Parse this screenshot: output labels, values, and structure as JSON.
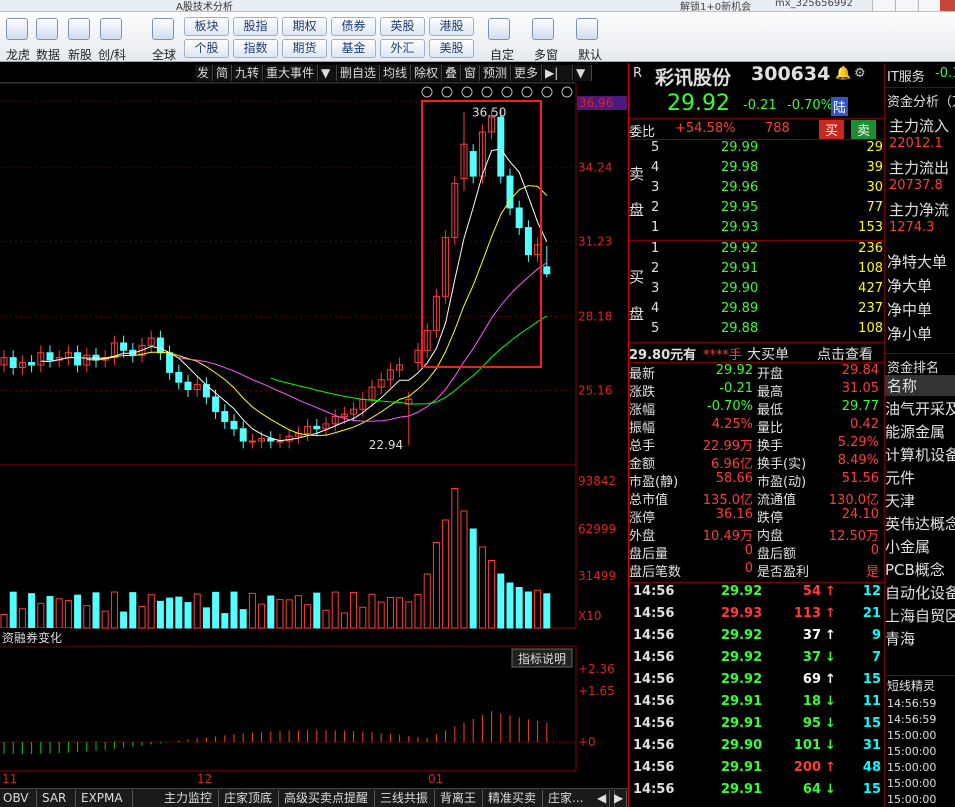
{
  "window": {
    "title": "A股技术分析",
    "notice1": "解锁1+0新机会",
    "notice2": "mx_325656992"
  },
  "toolbar": {
    "labels": [
      "龙虎",
      "数据",
      "新股",
      "创/科",
      "全球"
    ],
    "markets_row1": [
      "板块",
      "股指",
      "期权",
      "债券",
      "英股",
      "港股"
    ],
    "markets_row2": [
      "个股",
      "指数",
      "期货",
      "基金",
      "外汇",
      "美股"
    ],
    "right_labels": [
      "自定",
      "多窗",
      "默认"
    ]
  },
  "chart_toolbar": [
    "发",
    "简",
    "九转",
    "重大事件",
    "▼",
    "删自选",
    "均线",
    "除权",
    "叠",
    "窗",
    "预测",
    "更多",
    "▶|",
    "▼"
  ],
  "chart": {
    "price_axis": [
      "36.96",
      "34.24",
      "31.23",
      "28.18",
      "25.16"
    ],
    "high_label": "36.50",
    "low_label": "22.94",
    "vol_axis": [
      "93842",
      "62999",
      "31499",
      "X10"
    ],
    "macd_axis": [
      "+2.36",
      "+1.65",
      "+0"
    ],
    "x_labels": [
      "11",
      "12",
      "01"
    ],
    "margin_label": "资融券变化",
    "indicator_note": "指标说明"
  },
  "chart_data": {
    "type": "candlestick",
    "title": "",
    "ylim": [
      22.94,
      36.96
    ],
    "high": 36.5,
    "low": 22.94,
    "last": 29.92
  },
  "stock": {
    "flag": "R",
    "name": "彩讯股份",
    "code": "300634",
    "price": "29.92",
    "change": "-0.21",
    "pct": "-0.70%",
    "tag": "陆"
  },
  "weibi": {
    "label": "委比",
    "value": "+54.58%",
    "diff": "788",
    "sell_btn": "买",
    "buy_btn": "卖"
  },
  "sell_label": [
    "卖",
    "盘"
  ],
  "buy_label": [
    "买",
    "盘"
  ],
  "sell": [
    [
      "5",
      "29.99",
      "29"
    ],
    [
      "4",
      "29.98",
      "39"
    ],
    [
      "3",
      "29.96",
      "30"
    ],
    [
      "2",
      "29.95",
      "77"
    ],
    [
      "1",
      "29.93",
      "153"
    ]
  ],
  "buy": [
    [
      "1",
      "29.92",
      "236"
    ],
    [
      "2",
      "29.91",
      "108"
    ],
    [
      "3",
      "29.90",
      "427"
    ],
    [
      "4",
      "29.89",
      "237"
    ],
    [
      "5",
      "29.88",
      "108"
    ]
  ],
  "big_order": {
    "price": "29.80元有",
    "stars": "****手",
    "label": "大买单",
    "link": "点击查看"
  },
  "quote": [
    [
      "最新",
      "29.92",
      "开盘",
      "29.84"
    ],
    [
      "涨跌",
      "-0.21",
      "最高",
      "31.05"
    ],
    [
      "涨幅",
      "-0.70%",
      "最低",
      "29.77"
    ],
    [
      "振幅",
      "4.25%",
      "量比",
      "0.42"
    ],
    [
      "总手",
      "22.99万",
      "换手",
      "5.29%"
    ],
    [
      "金额",
      "6.96亿",
      "换手(实)",
      "8.49%"
    ],
    [
      "市盈(静)",
      "58.66",
      "市盈(动)",
      "51.56"
    ],
    [
      "总市值",
      "135.0亿",
      "流通值",
      "130.0亿"
    ],
    [
      "涨停",
      "36.16",
      "跌停",
      "24.10"
    ],
    [
      "外盘",
      "10.49万",
      "内盘",
      "12.50万"
    ],
    [
      "盘后量",
      "0",
      "盘后额",
      "0"
    ],
    [
      "盘后笔数",
      "0",
      "是否盈利",
      "是"
    ]
  ],
  "ticks": [
    [
      "14:56",
      "29.92",
      "54",
      "12"
    ],
    [
      "14:56",
      "29.93",
      "113",
      "21"
    ],
    [
      "14:56",
      "29.92",
      "37",
      "9"
    ],
    [
      "14:56",
      "29.92",
      "37",
      "7"
    ],
    [
      "14:56",
      "29.92",
      "69",
      "15"
    ],
    [
      "14:56",
      "29.91",
      "18",
      "11"
    ],
    [
      "14:56",
      "29.91",
      "95",
      "15"
    ],
    [
      "14:56",
      "29.90",
      "101",
      "31"
    ],
    [
      "14:56",
      "29.91",
      "200",
      "48"
    ],
    [
      "14:56",
      "29.91",
      "64",
      "15"
    ]
  ],
  "far_right": {
    "top": "IT服务",
    "top_val": "-0.1",
    "fund_title": "资金分析（万",
    "fund_rows": [
      "主力流入",
      "22012.1",
      "主力流出",
      "20737.8",
      "主力净流",
      "1274.3"
    ],
    "net_rows": [
      "净特大单",
      "净大单",
      "净中单",
      "净小单"
    ],
    "rank_title": "资金排名",
    "rank_rows": [
      "名称",
      "油气开采及",
      "能源金属",
      "计算机设备",
      "元件",
      "天津",
      "英伟达概念",
      "小金属",
      "PCB概念",
      "自动化设备",
      "上海自贸区",
      "青海"
    ],
    "short_title": "短线精灵",
    "short_rows": [
      "14:56:59",
      "14:56:59",
      "15:00:00",
      "15:00:00",
      "15:00:00",
      "15:00:00",
      "15:00:00"
    ]
  },
  "bottom_tabs": [
    "OBV",
    "SAR",
    "EXPMA",
    "主力监控",
    "庄家顶底",
    "高级买卖点提醒",
    "三线共振",
    "背离王",
    "精准买卖",
    "庄家..."
  ]
}
